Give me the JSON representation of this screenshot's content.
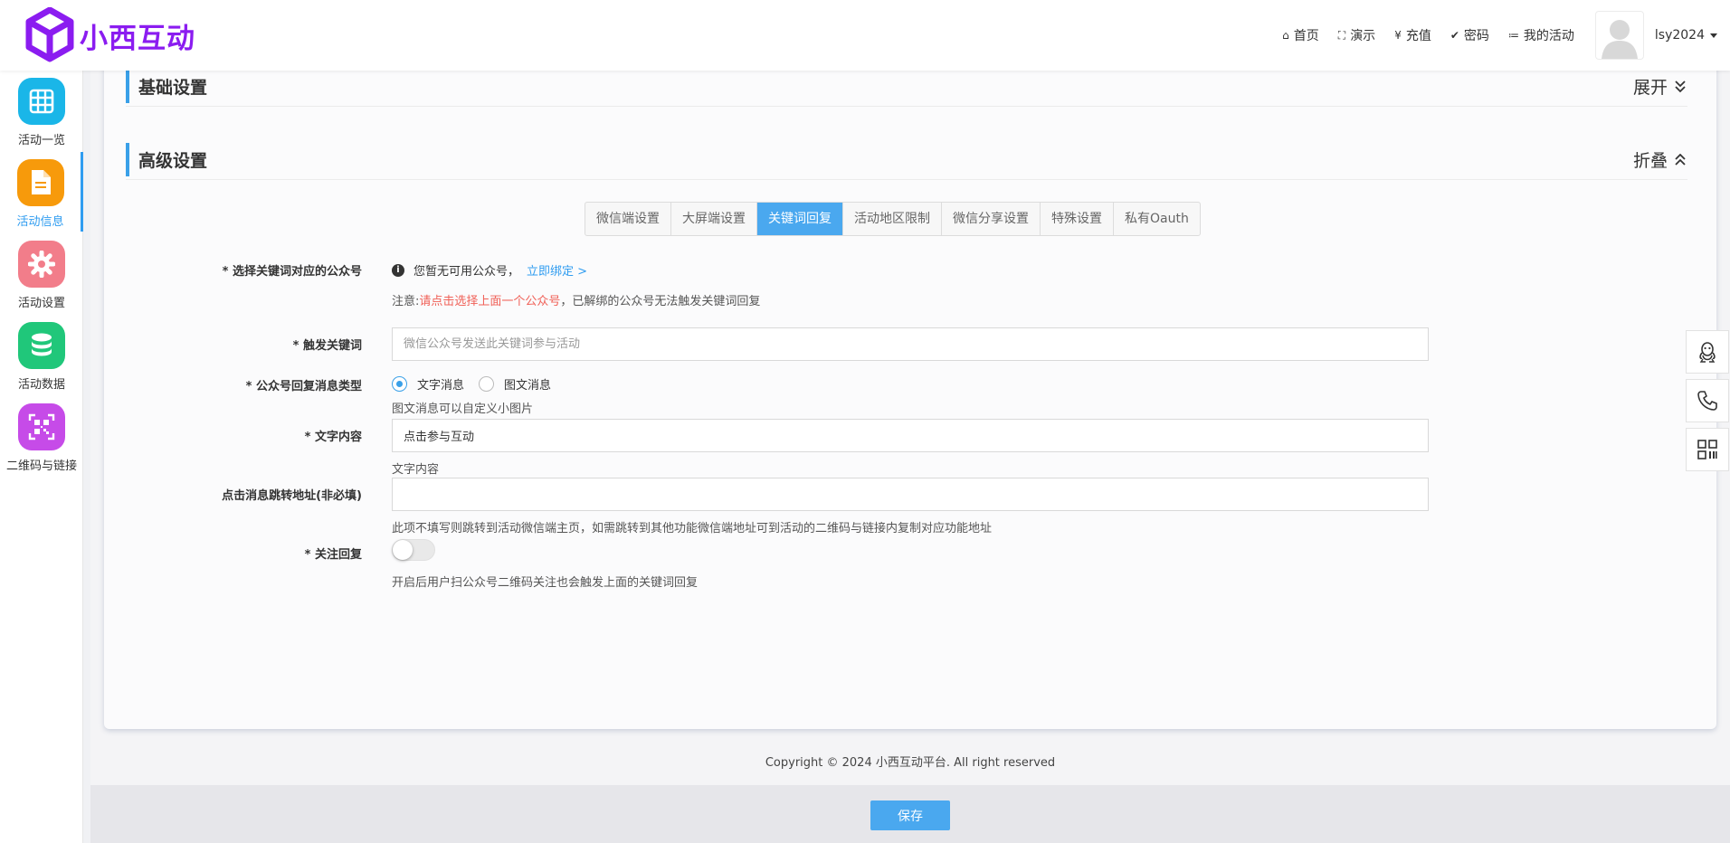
{
  "brand": {
    "name": "小西互动",
    "color": "#8b1cf0"
  },
  "topnav": [
    {
      "icon": "home-icon",
      "glyph": "⌂",
      "label": "首页"
    },
    {
      "icon": "expand-icon",
      "glyph": "⛶",
      "label": "演示"
    },
    {
      "icon": "yen-icon",
      "glyph": "¥",
      "label": "充值"
    },
    {
      "icon": "check-circle-icon",
      "glyph": "✔",
      "label": "密码"
    },
    {
      "icon": "list-icon",
      "glyph": "≔",
      "label": "我的活动"
    }
  ],
  "user": {
    "name": "lsy2024"
  },
  "sidebar": {
    "items": [
      {
        "label": "活动一览",
        "icon": "grid-icon",
        "color": "#1ab6e8"
      },
      {
        "label": "活动信息",
        "icon": "document-icon",
        "color": "#f79a0b",
        "active": true
      },
      {
        "label": "活动设置",
        "icon": "gear-icon",
        "color": "#f27d8a"
      },
      {
        "label": "活动数据",
        "icon": "database-icon",
        "color": "#20c77a"
      },
      {
        "label": "二维码与链接",
        "icon": "qrcode-icon",
        "color": "#c64be8"
      }
    ]
  },
  "sections": {
    "basic": {
      "title": "基础设置",
      "toggle": "展开"
    },
    "advanced": {
      "title": "高级设置",
      "toggle": "折叠"
    }
  },
  "tabs": [
    "微信端设置",
    "大屏端设置",
    "关键词回复",
    "活动地区限制",
    "微信分享设置",
    "特殊设置",
    "私有Oauth"
  ],
  "active_tab": "关键词回复",
  "form": {
    "account": {
      "label": "* 选择关键词对应的公众号",
      "info": "您暂无可用公众号，",
      "link": "立即绑定 >",
      "note_prefix": "注意:",
      "note_red": "请点击选择上面一个公众号",
      "note_suffix": "，已解绑的公众号无法触发关键词回复"
    },
    "keyword": {
      "label": "* 触发关键词",
      "value": "",
      "placeholder": "微信公众号发送此关键词参与活动"
    },
    "reply_type": {
      "label": "* 公众号回复消息类型",
      "options": [
        "文字消息",
        "图文消息"
      ],
      "selected": "文字消息",
      "help": "图文消息可以自定义小图片"
    },
    "text_content": {
      "label": "* 文字内容",
      "value": "点击参与互动",
      "help": "文字内容"
    },
    "jump_url": {
      "label": "点击消息跳转地址(非必填)",
      "value": "",
      "help": "此项不填写则跳转到活动微信端主页，如需跳转到其他功能微信端地址可到活动的二维码与链接内复制对应功能地址"
    },
    "follow_reply": {
      "label": "* 关注回复",
      "enabled": false,
      "help": "开启后用户扫公众号二维码关注也会触发上面的关键词回复"
    }
  },
  "copyright": "Copyright © 2024 小西互动平台. All right reserved",
  "save_label": "保存",
  "float_buttons": [
    "qq-icon",
    "phone-icon",
    "qrcode-icon"
  ]
}
